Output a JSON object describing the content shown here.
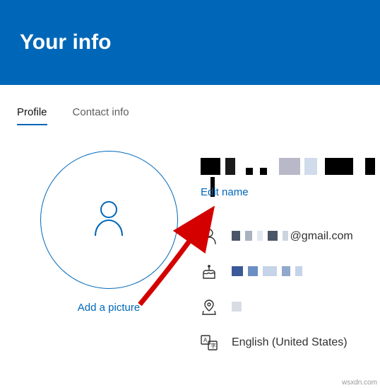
{
  "header": {
    "title": "Your info"
  },
  "tabs": {
    "profile": "Profile",
    "contact": "Contact info"
  },
  "avatar": {
    "add_picture": "Add a picture"
  },
  "info": {
    "edit_name": "Edit name",
    "email_domain": "@gmail.com",
    "language": "English (United States)"
  },
  "watermark": "wsxdn.com"
}
